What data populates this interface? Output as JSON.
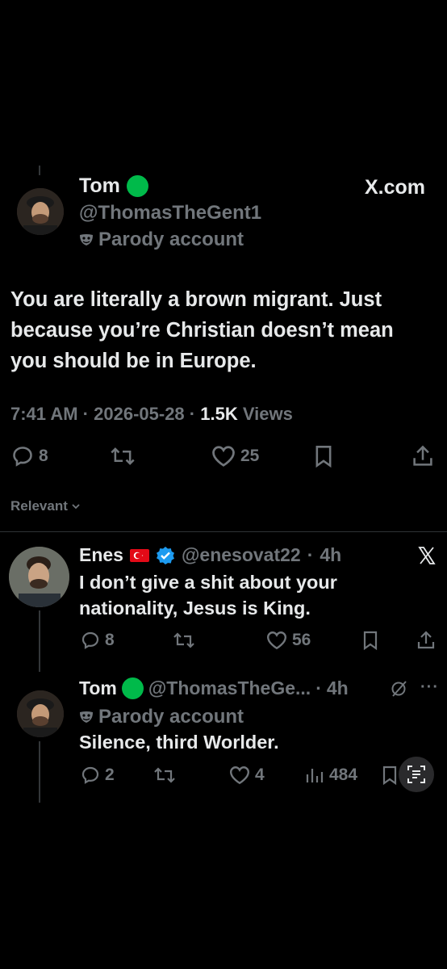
{
  "main_post": {
    "name": "Tom",
    "handle": "@ThomasTheGent1",
    "label": "Parody account",
    "source": "X.com",
    "text_lines": [
      "You are literally a brown migrant. Just",
      "because you’re Christian doesn’t mean",
      "you should be in Europe."
    ],
    "time": "7:41 AM",
    "date": "2026-05-28",
    "sep": "·",
    "views_count": "1.5K",
    "views_label": "Views",
    "replies": "8",
    "likes": "25"
  },
  "sort": {
    "label": "Relevant"
  },
  "reply1": {
    "name": "Enes",
    "handle": "@enesovat22",
    "time": "4h",
    "sep": "·",
    "text_lines": [
      "I don’t give a shit about your",
      "nationality, Jesus is King."
    ],
    "replies": "8",
    "likes": "56"
  },
  "reply2": {
    "name": "Tom",
    "handle": "@ThomasTheGe...",
    "time": "4h",
    "sep": "·",
    "label": "Parody account",
    "text": "Silence, third Worlder.",
    "replies": "2",
    "likes": "4",
    "views": "484"
  },
  "colors": {
    "background": "#000000",
    "text": "#e7e9ea",
    "secondary": "#71767b",
    "verified": "#1d9bf0",
    "status_green": "#00ba4a"
  }
}
